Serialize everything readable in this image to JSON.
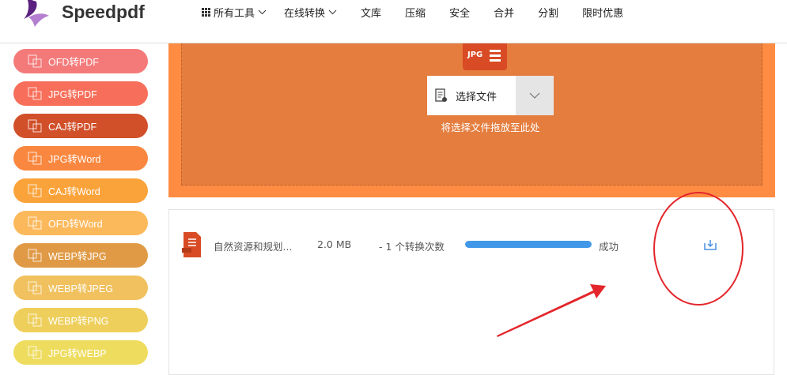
{
  "header": {
    "brand": "Speedpdf",
    "nav": [
      {
        "label": "所有工具",
        "dropdown": true,
        "icon": "grid-icon"
      },
      {
        "label": "在线转换",
        "dropdown": true
      },
      {
        "label": "文库"
      },
      {
        "label": "压缩"
      },
      {
        "label": "安全"
      },
      {
        "label": "合并"
      },
      {
        "label": "分割"
      },
      {
        "label": "限时优惠"
      }
    ]
  },
  "sidebar": [
    {
      "label": "OFD转PDF",
      "color": "#f47a7a"
    },
    {
      "label": "JPG转PDF",
      "color": "#f76f5a"
    },
    {
      "label": "CAJ转PDF",
      "color": "#d1502a"
    },
    {
      "label": "JPG转Word",
      "color": "#f9873f"
    },
    {
      "label": "CAJ转Word",
      "color": "#fba33b"
    },
    {
      "label": "OFD转Word",
      "color": "#fcb95c"
    },
    {
      "label": "WEBP转JPG",
      "color": "#e09a45"
    },
    {
      "label": "WEBP转JPEG",
      "color": "#f0c15e"
    },
    {
      "label": "WEBP转PNG",
      "color": "#eecf5c"
    },
    {
      "label": "JPG转WEBP",
      "color": "#eedc5f"
    }
  ],
  "upload": {
    "badge": "JPG",
    "select_label": "选择文件",
    "hint": "将选择文件拖放至此处"
  },
  "file": {
    "name": "自然资源和规划...",
    "size": "2.0 MB",
    "count": "- 1 个转换次数",
    "progress": 100,
    "status": "成功"
  }
}
